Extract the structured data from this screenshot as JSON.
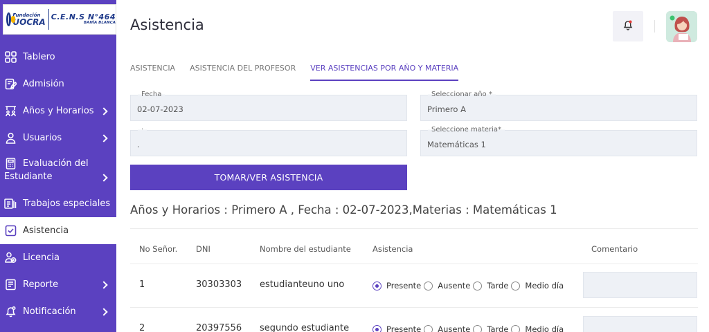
{
  "logo": {
    "fundacion": "Fundación",
    "uocra": "UOCRA",
    "cens": "C.E.N.S N°464",
    "city": "BAHÍA BLANCA"
  },
  "sidebar": {
    "items": [
      {
        "label": "Tablero",
        "icon": "dashboard-grid-icon"
      },
      {
        "label": "Admisión",
        "icon": "edit-document-icon"
      },
      {
        "label": "Años y Horarios",
        "icon": "classroom-icon"
      },
      {
        "label": "Usuarios",
        "icon": "user-icon"
      },
      {
        "label_line1": "Evaluación del",
        "label_line2": "Estudiante",
        "icon": "calculator-icon"
      },
      {
        "label": "Trabajos especiales",
        "icon": "projects-icon"
      },
      {
        "label": "Asistencia",
        "icon": "checkbox-icon"
      },
      {
        "label": "Licencia",
        "icon": "users-license-icon"
      },
      {
        "label": "Reporte",
        "icon": "report-icon"
      },
      {
        "label": "Notificación",
        "icon": "notification-icon"
      }
    ]
  },
  "header": {
    "title": "Asistencia"
  },
  "tabs": [
    {
      "label": "ASISTENCIA"
    },
    {
      "label": "ASISTENCIA DEL PROFESOR"
    },
    {
      "label": "VER ASISTENCIAS POR AÑO Y MATERIA"
    }
  ],
  "form": {
    "fecha_label": "Fecha",
    "fecha_value": "02-07-2023",
    "anio_label": "Seleccionar año *",
    "anio_value": "Primero A",
    "extra_label": "·",
    "extra_value": ".",
    "materia_label": "Seleccione materia*",
    "materia_value": "Matemáticas 1",
    "submit_label": "TOMAR/VER ASISTENCIA"
  },
  "summary": "Años y Horarios : Primero A , Fecha : 02-07-2023,Materias : Matemáticas 1",
  "table": {
    "headers": [
      "No Señor.",
      "DNI",
      "Nombre del estudiante",
      "Asistencia",
      "Comentario"
    ],
    "options": [
      "Presente",
      "Ausente",
      "Tarde",
      "Medio día"
    ],
    "rows": [
      {
        "no": "1",
        "dni": "30303303",
        "name": "estudianteuno uno",
        "selected": "Presente"
      },
      {
        "no": "2",
        "dni": "20397556",
        "name": "segundo estudiante",
        "selected": "Presente"
      }
    ]
  },
  "colors": {
    "brand": "#5b41c0",
    "field_bg": "#eef1f6"
  }
}
